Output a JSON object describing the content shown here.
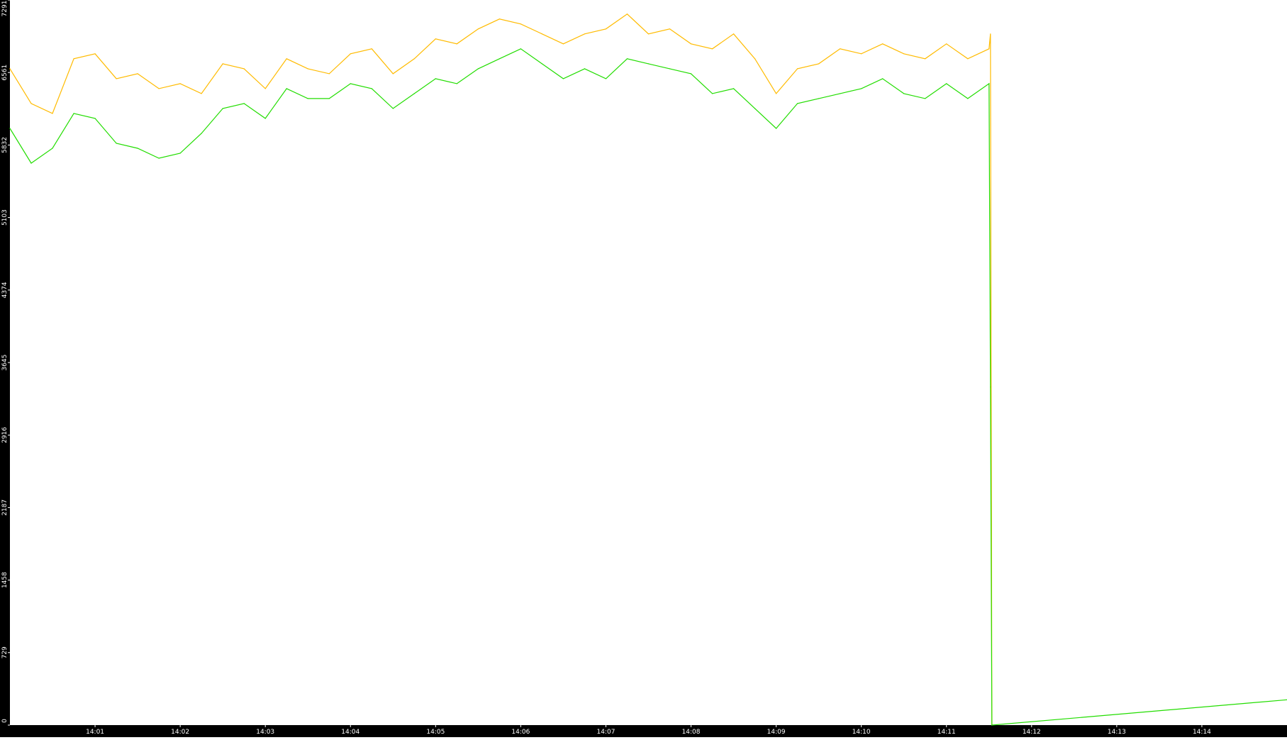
{
  "chart_data": {
    "type": "line",
    "title": "",
    "xlabel": "",
    "ylabel": "",
    "background": "#ffffff",
    "axis_color": "#000000",
    "tick_label_color": "#ffffff",
    "grid": false,
    "legend": "none",
    "x_axis": {
      "unit": "time",
      "range": [
        "14:00:00",
        "14:15:00"
      ],
      "tick_labels": [
        "14:01",
        "14:02",
        "14:03",
        "14:04",
        "14:05",
        "14:06",
        "14:07",
        "14:08",
        "14:09",
        "14:10",
        "14:11",
        "14:12",
        "14:13",
        "14:14"
      ]
    },
    "y_axis": {
      "range": [
        0,
        7291
      ],
      "tick_labels": [
        "0",
        "729",
        "1458",
        "2187",
        "2916",
        "3645",
        "4374",
        "5103",
        "5832",
        "6561",
        "7291"
      ]
    },
    "series": [
      {
        "color": "#ffbb00",
        "x": [
          "14:00:00",
          "14:00:15",
          "14:00:30",
          "14:00:45",
          "14:01:00",
          "14:01:15",
          "14:01:30",
          "14:01:45",
          "14:02:00",
          "14:02:15",
          "14:02:30",
          "14:02:45",
          "14:03:00",
          "14:03:15",
          "14:03:30",
          "14:03:45",
          "14:04:00",
          "14:04:15",
          "14:04:30",
          "14:04:45",
          "14:05:00",
          "14:05:15",
          "14:05:30",
          "14:05:45",
          "14:06:00",
          "14:06:15",
          "14:06:30",
          "14:06:45",
          "14:07:00",
          "14:07:15",
          "14:07:30",
          "14:07:45",
          "14:08:00",
          "14:08:15",
          "14:08:30",
          "14:08:45",
          "14:09:00",
          "14:09:15",
          "14:09:30",
          "14:09:45",
          "14:10:00",
          "14:10:15",
          "14:10:30",
          "14:10:45",
          "14:11:00",
          "14:11:15",
          "14:11:30",
          "14:11:31",
          "14:11:32"
        ],
        "y": [
          6600,
          6250,
          6150,
          6700,
          6750,
          6500,
          6550,
          6400,
          6450,
          6350,
          6650,
          6600,
          6400,
          6700,
          6600,
          6550,
          6750,
          6800,
          6550,
          6700,
          6900,
          6850,
          7000,
          7100,
          7050,
          6950,
          6850,
          6950,
          7000,
          7150,
          6950,
          7000,
          6850,
          6800,
          6950,
          6700,
          6350,
          6600,
          6650,
          6800,
          6750,
          6850,
          6750,
          6700,
          6850,
          6700,
          6800,
          6950,
          0
        ]
      },
      {
        "color": "#22dd00",
        "x": [
          "14:00:00",
          "14:00:15",
          "14:00:30",
          "14:00:45",
          "14:01:00",
          "14:01:15",
          "14:01:30",
          "14:01:45",
          "14:02:00",
          "14:02:15",
          "14:02:30",
          "14:02:45",
          "14:03:00",
          "14:03:15",
          "14:03:30",
          "14:03:45",
          "14:04:00",
          "14:04:15",
          "14:04:30",
          "14:04:45",
          "14:05:00",
          "14:05:15",
          "14:05:30",
          "14:05:45",
          "14:06:00",
          "14:06:15",
          "14:06:30",
          "14:06:45",
          "14:07:00",
          "14:07:15",
          "14:07:30",
          "14:07:45",
          "14:08:00",
          "14:08:15",
          "14:08:30",
          "14:08:45",
          "14:09:00",
          "14:09:15",
          "14:09:30",
          "14:09:45",
          "14:10:00",
          "14:10:15",
          "14:10:30",
          "14:10:45",
          "14:11:00",
          "14:11:15",
          "14:11:30",
          "14:11:31",
          "14:11:32",
          "14:15:00"
        ],
        "y": [
          6000,
          5650,
          5800,
          6150,
          6100,
          5850,
          5800,
          5700,
          5750,
          5950,
          6200,
          6250,
          6100,
          6400,
          6300,
          6300,
          6450,
          6400,
          6200,
          6350,
          6500,
          6450,
          6600,
          6700,
          6800,
          6650,
          6500,
          6600,
          6500,
          6700,
          6650,
          6600,
          6550,
          6350,
          6400,
          6200,
          6000,
          6250,
          6300,
          6350,
          6400,
          6500,
          6350,
          6300,
          6450,
          6300,
          6450,
          3400,
          0,
          255
        ]
      }
    ]
  }
}
